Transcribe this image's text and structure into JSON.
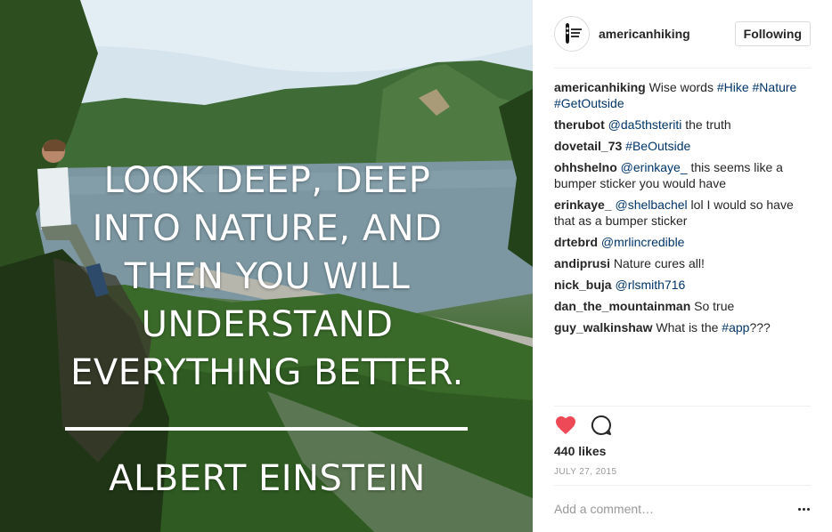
{
  "photo": {
    "quote_lines": [
      "LOOK DEEP, DEEP",
      "INTO NATURE, AND",
      "THEN YOU WILL",
      "UNDERSTAND",
      "EVERYTHING BETTER."
    ],
    "author": "ALBERT EINSTEIN"
  },
  "header": {
    "avatar_icon": "american-hiking-society-logo-icon",
    "username": "americanhiking",
    "follow_label": "Following"
  },
  "comments": [
    {
      "user": "americanhiking",
      "parts": [
        {
          "t": "Wise words "
        },
        {
          "t": "#Hike",
          "tag": true
        },
        {
          "t": " "
        },
        {
          "t": "#Nature",
          "tag": true
        },
        {
          "t": " "
        },
        {
          "t": "#GetOutside",
          "tag": true
        }
      ]
    },
    {
      "user": "therubot",
      "parts": [
        {
          "t": "@da5thsteriti",
          "tag": true
        },
        {
          "t": " the truth"
        }
      ]
    },
    {
      "user": "dovetail_73",
      "parts": [
        {
          "t": "#BeOutside",
          "tag": true
        }
      ]
    },
    {
      "user": "ohhshelno",
      "parts": [
        {
          "t": "@erinkaye_",
          "tag": true
        },
        {
          "t": " this seems like a bumper sticker you would have"
        }
      ]
    },
    {
      "user": "erinkaye_",
      "parts": [
        {
          "t": "@shelbachel",
          "tag": true
        },
        {
          "t": " lol I would so have that as a bumper sticker"
        }
      ]
    },
    {
      "user": "drtebrd",
      "parts": [
        {
          "t": "@mrlincredible",
          "tag": true
        }
      ]
    },
    {
      "user": "andiprusi",
      "parts": [
        {
          "t": "Nature cures all!"
        }
      ]
    },
    {
      "user": "nick_buja",
      "parts": [
        {
          "t": "@rlsmith716",
          "tag": true
        }
      ]
    },
    {
      "user": "dan_the_mountainman",
      "parts": [
        {
          "t": "So true"
        }
      ]
    },
    {
      "user": "guy_walkinshaw",
      "parts": [
        {
          "t": "What is the "
        },
        {
          "t": "#app",
          "tag": true
        },
        {
          "t": "???"
        }
      ]
    }
  ],
  "actions": {
    "like_icon": "heart-filled-icon",
    "comment_icon": "comment-bubble-icon",
    "like_color": "#ed4956"
  },
  "likes": "440 likes",
  "date": "JULY 27, 2015",
  "comment_input": {
    "placeholder": "Add a comment…",
    "more_icon": "more-options-icon"
  }
}
